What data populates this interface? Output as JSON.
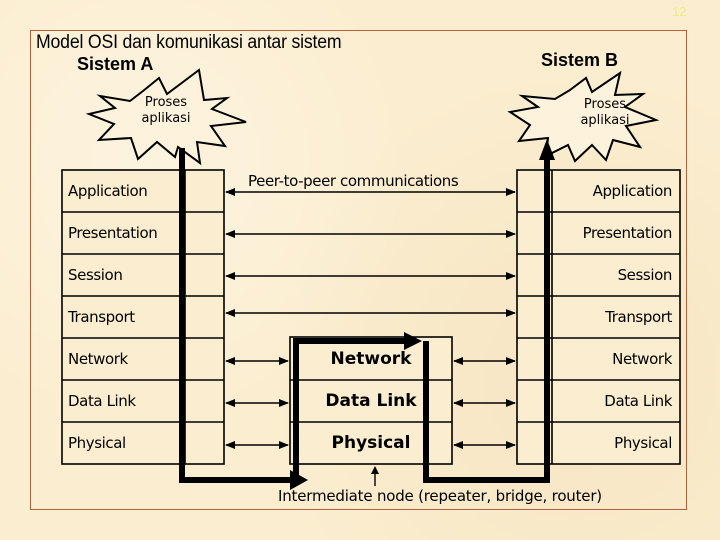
{
  "slide_number": "12",
  "title": "Model OSI dan komunikasi antar sistem",
  "system_a": {
    "label": "Sistem A",
    "process_label_line1": "Proses",
    "process_label_line2": "aplikasi",
    "layers": [
      "Application",
      "Presentation",
      "Session",
      "Transport",
      "Network",
      "Data Link",
      "Physical"
    ]
  },
  "system_b": {
    "label": "Sistem B",
    "process_label_line1": "Proses",
    "process_label_line2": "aplikasi",
    "layers": [
      "Application",
      "Presentation",
      "Session",
      "Transport",
      "Network",
      "Data Link",
      "Physical"
    ]
  },
  "intermediate_node": {
    "layers": [
      "Network",
      "Data Link",
      "Physical"
    ],
    "caption": "Intermediate node (repeater, bridge, router)"
  },
  "peer_label": "Peer-to-peer communications",
  "colors": {
    "background": "#fbedcf",
    "frame_border": "#b0633a",
    "slide_number": "#ecec86",
    "line": "#000000"
  }
}
